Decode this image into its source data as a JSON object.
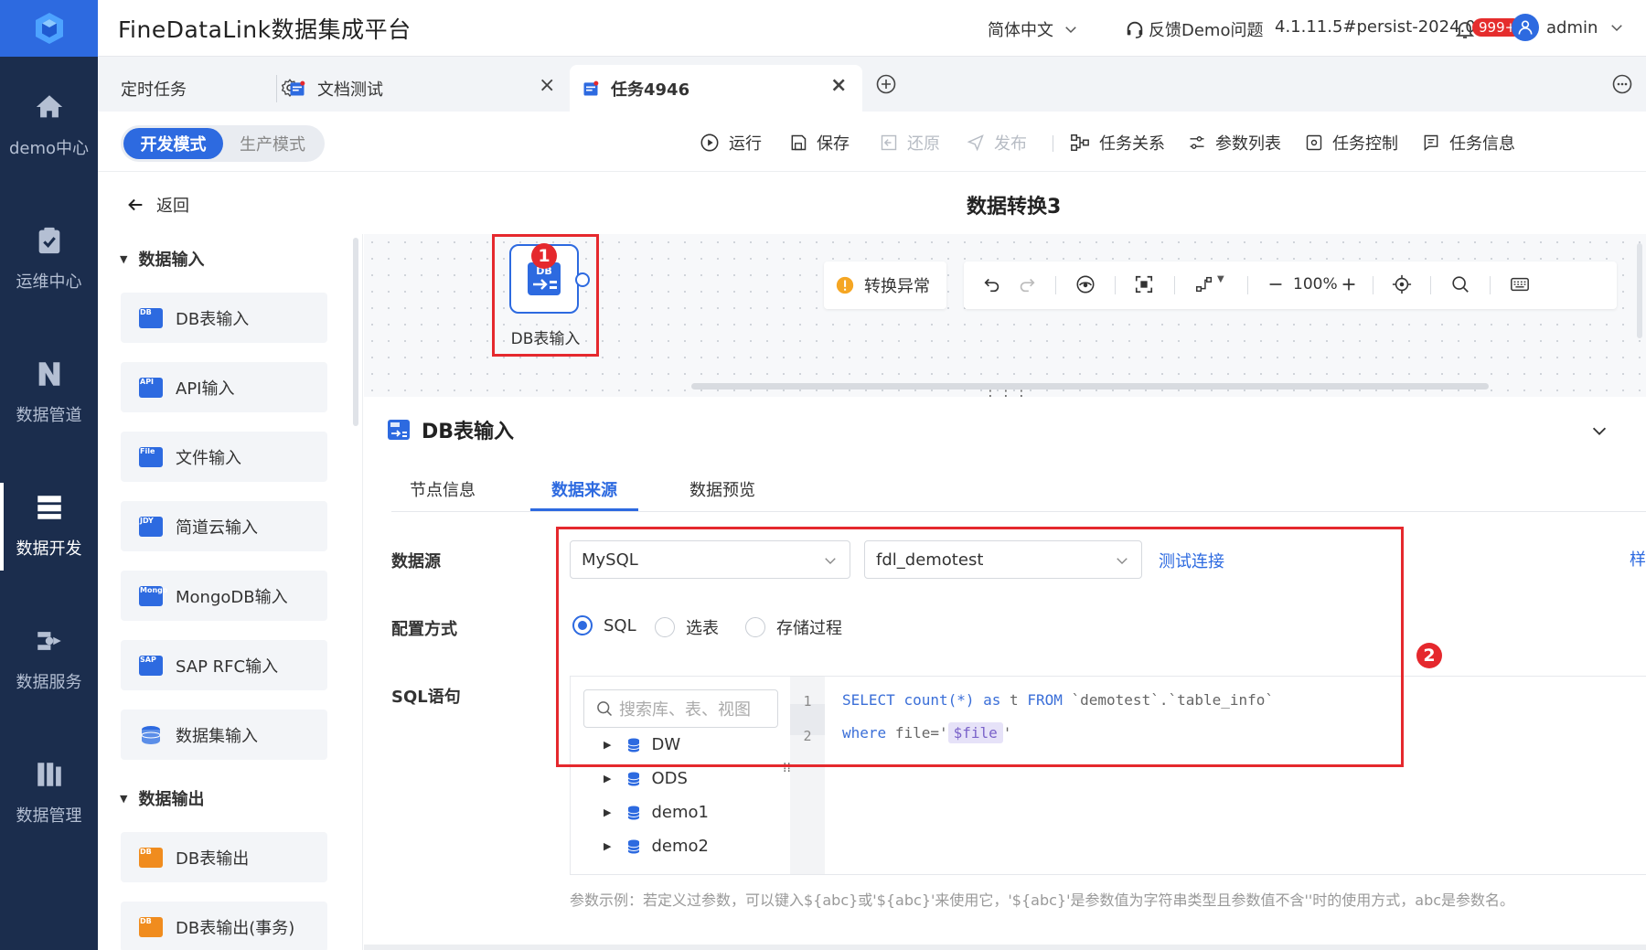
{
  "header": {
    "app_title": "FineDataLink数据集成平台",
    "language": "简体中文",
    "feedback": "反馈Demo问题",
    "version": "4.1.11.5#persist-2024.08.29",
    "notif_count": "999+",
    "user": "admin"
  },
  "nav": {
    "items": [
      {
        "label": "demo中心",
        "icon": "home-icon"
      },
      {
        "label": "运维中心",
        "icon": "clipboard-check-icon"
      },
      {
        "label": "数据管道",
        "icon": "pipeline-icon"
      },
      {
        "label": "数据开发",
        "icon": "server-stack-icon",
        "active": true
      },
      {
        "label": "数据服务",
        "icon": "api-service-icon"
      },
      {
        "label": "数据管理",
        "icon": "management-icon"
      }
    ]
  },
  "tabs": [
    {
      "label": "定时任务"
    },
    {
      "label": "文档测试"
    },
    {
      "label": "任务4946",
      "active": true
    }
  ],
  "toolbar": {
    "mode_dev": "开发模式",
    "mode_prod": "生产模式",
    "run": "运行",
    "save": "保存",
    "revert": "还原",
    "publish": "发布",
    "relations": "任务关系",
    "params": "参数列表",
    "control": "任务控制",
    "info": "任务信息"
  },
  "breadcrumb": {
    "back": "返回",
    "title": "数据转换3"
  },
  "sidebar": {
    "input_group": "数据输入",
    "inputs": [
      {
        "label": "DB表输入",
        "tag": "DB",
        "color": "#2d6ae0"
      },
      {
        "label": "API输入",
        "tag": "API",
        "color": "#2d6ae0"
      },
      {
        "label": "文件输入",
        "tag": "File",
        "color": "#2d6ae0"
      },
      {
        "label": "简道云输入",
        "tag": "JDY",
        "color": "#2d6ae0"
      },
      {
        "label": "MongoDB输入",
        "tag": "Mongo",
        "color": "#2d6ae0"
      },
      {
        "label": "SAP RFC输入",
        "tag": "SAP",
        "color": "#2d6ae0"
      },
      {
        "label": "数据集输入",
        "tag": "",
        "color": "#2d6ae0"
      }
    ],
    "output_group": "数据输出",
    "outputs": [
      {
        "label": "DB表输出",
        "tag": "DB",
        "color": "#f08c1e"
      },
      {
        "label": "DB表输出(事务)",
        "tag": "DB",
        "color": "#f08c1e"
      }
    ]
  },
  "canvas": {
    "node_label": "DB表输入",
    "node_tag": "DB",
    "marker1": "1",
    "marker2": "2",
    "warning": "转换异常",
    "zoom": "100%"
  },
  "panel": {
    "title": "DB表输入",
    "tabs": [
      "节点信息",
      "数据来源",
      "数据预览"
    ],
    "active_tab": "数据来源",
    "datasource_label": "数据源",
    "datasource_type": "MySQL",
    "datasource_conn": "fdl_demotest",
    "test_link": "测试连接",
    "config_label": "配置方式",
    "config_options": [
      "SQL",
      "选表",
      "存储过程"
    ],
    "config_selected": "SQL",
    "sql_label": "SQL语句",
    "search_placeholder": "搜索库、表、视图",
    "tree": [
      "DW",
      "ODS",
      "demo1",
      "demo2"
    ],
    "code": {
      "l1_kw1": "SELECT",
      "l1_fn": "count(*)",
      "l1_as": "as",
      "l1_t": "t",
      "l1_from": "FROM",
      "l1_tbl": "`demotest`.`table_info`",
      "l2_where": "where",
      "l2_a": "file='",
      "l2_var": "$file",
      "l2_b": "'"
    },
    "hint": "参数示例：若定义过参数，可以键入${abc}或'${abc}'来使用它，'${abc}'是参数值为字符串类型且参数值不含''时的使用方式，abc是参数名。",
    "edge_text": "样"
  }
}
